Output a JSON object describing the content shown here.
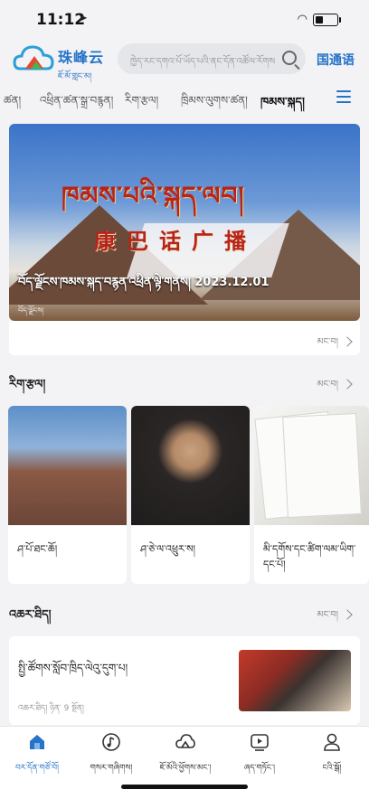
{
  "status_bar": {
    "time": "11:12"
  },
  "header": {
    "brand_cn": "珠峰云",
    "brand_bo": "ཇོ་མོ་གླང་མ།",
    "search_placeholder": "ཁྱེད་རང་དགའ་པོ་ཡོད་པའི་ནང་དོན་འཚོལ་རོགས།",
    "lang_button": "国通语"
  },
  "tabs": [
    {
      "label": "ཚན།"
    },
    {
      "label": "འཕྲིན་ཚན་སྒྲ་བརྙན།"
    },
    {
      "label": "རིག་རྩལ།"
    },
    {
      "label": "ཁྲིམས་ལུགས་ཚན།"
    },
    {
      "label": "ཁམས་སྐད།",
      "active": true
    }
  ],
  "banner": {
    "title_bo": "ཁམས་པའི་སྐད་ལབ།",
    "title_cn": "康巴话广播",
    "caption": "བོད་ལྗོངས་ཁམས་སྐད་བརྙན་འཕྲིན་ལྟེ་གནས། 2023.12.01",
    "source": "བོད་ལྗོངས།",
    "more_label": "མང་བ།"
  },
  "section_culture": {
    "title": "རིག་རྩལ།",
    "more_label": "མང་བ།",
    "items": [
      {
        "label": "ཤ་པོ་ཐང་ཆོ།"
      },
      {
        "label": "ཤ་ཅེ་ལ་འཕྲུར་ས།"
      },
      {
        "label": "མི་དགོས་དང་ཚིག་ལམ་ཡིག་དང་པོ།"
      }
    ]
  },
  "section_news": {
    "title": "འཆར་ཐིད།",
    "more_label": "མང་བ།",
    "item": {
      "title": "སྤྱི་ཚོགས་སློབ་ཁྲིད་ལེའུ་དུག་པ།",
      "meta": "འཆར་ཐིད། ཉིན་ 9 སྔོན།"
    }
  },
  "bottom_nav": [
    {
      "label": "བར་དོན་གཙོ་བོ།",
      "active": true
    },
    {
      "label": "གསར་གཞིགས།"
    },
    {
      "label": "ཇོ་མོའི་ཕྱོགས་མང་།"
    },
    {
      "label": "ཞད་གཏོང་།"
    },
    {
      "label": "ངའི་སྒོ།"
    }
  ],
  "colors": {
    "accent": "#2673c8",
    "title_red": "#b8231c"
  }
}
